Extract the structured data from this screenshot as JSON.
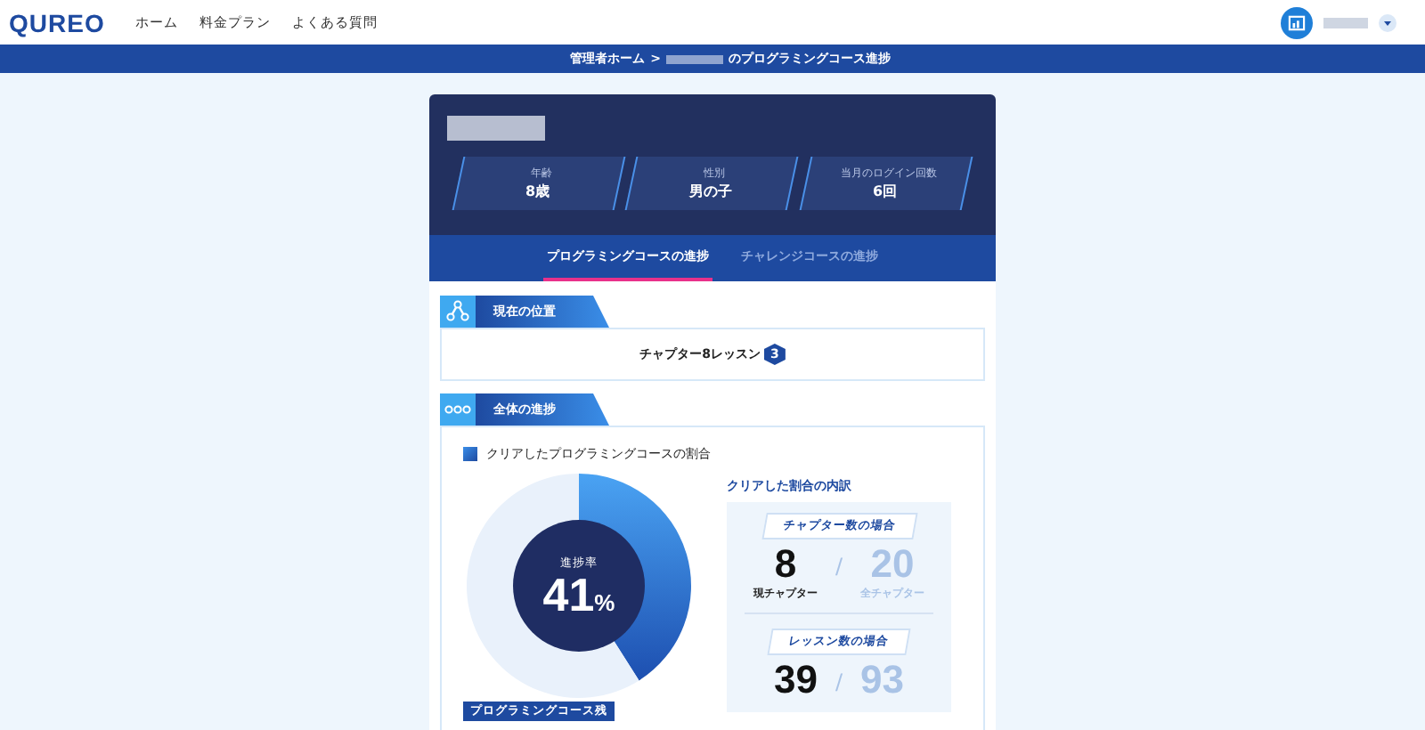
{
  "header": {
    "logo": "QUREO",
    "nav": [
      {
        "label": "ホーム"
      },
      {
        "label": "料金プラン"
      },
      {
        "label": "よくある質問"
      }
    ]
  },
  "breadcrumb": {
    "home": "管理者ホーム",
    "separator": ">",
    "current": "のプログラミングコース進捗"
  },
  "profile": {
    "stats": [
      {
        "label": "年齢",
        "value": "8歳"
      },
      {
        "label": "性別",
        "value": "男の子"
      },
      {
        "label": "当月のログイン回数",
        "value": "6回"
      }
    ]
  },
  "tabs": [
    {
      "label": "プログラミングコースの進捗",
      "selected": true
    },
    {
      "label": "チャレンジコースの進捗",
      "selected": false
    }
  ],
  "current_position": {
    "title": "現在の位置",
    "text": "チャプター8レッスン",
    "badge": "3"
  },
  "overall": {
    "title": "全体の進捗",
    "subtitle": "クリアしたプログラミングコースの割合",
    "chart_data": {
      "type": "donut",
      "values": [
        41,
        59
      ]
    },
    "center_label": "進捗率",
    "center_value": "41",
    "center_unit": "%",
    "breakdown_title": "クリアした割合の内訳",
    "breakdowns": [
      {
        "title": "チャプター数の場合",
        "current": "8",
        "separator": "/",
        "total": "20",
        "current_label": "現チャプター",
        "total_label": "全チャプター"
      },
      {
        "title": "レッスン数の場合",
        "current": "39",
        "separator": "/",
        "total": "93"
      }
    ],
    "remaining_tag": "プログラミングコース残"
  }
}
